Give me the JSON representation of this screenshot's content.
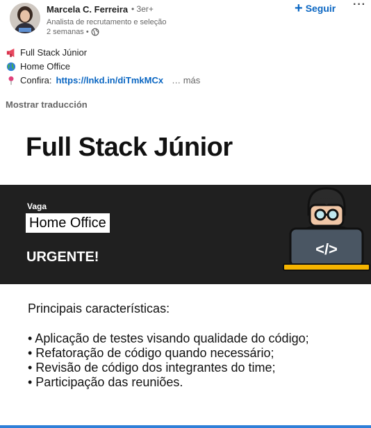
{
  "post": {
    "author_name": "Marcela C. Ferreira",
    "connection_degree": "• 3er+",
    "headline": "Analista de recrutamento e seleção",
    "time": "2 semanas •",
    "follow_label": "Seguir",
    "more_menu": "···",
    "lines": [
      {
        "icon": "megaphone-icon",
        "text": "Full Stack Júnior"
      },
      {
        "icon": "globe-icon",
        "text": "Home Office"
      },
      {
        "icon": "pin-icon",
        "prefix": "Confira:",
        "link": "https://lnkd.in/diTmkMCx",
        "more": "… más"
      }
    ],
    "translate_label": "Mostrar traducción"
  },
  "image": {
    "title": "Full Stack Júnior",
    "vaga": "Vaga",
    "home_office": "Home Office",
    "urgent": "URGENTE!",
    "features_title": "Principais características:",
    "features": [
      "• Aplicação de testes visando qualidade do código;",
      "• Refatoração de código quando necessário;",
      "• Revisão de código dos integrantes do time;",
      "• Participação das reuniões."
    ],
    "code_symbol": "</>"
  },
  "colors": {
    "accent": "#0a66c2",
    "banner": "#202020",
    "laptop": "#4a5663",
    "laptop_base": "#f5b400"
  }
}
